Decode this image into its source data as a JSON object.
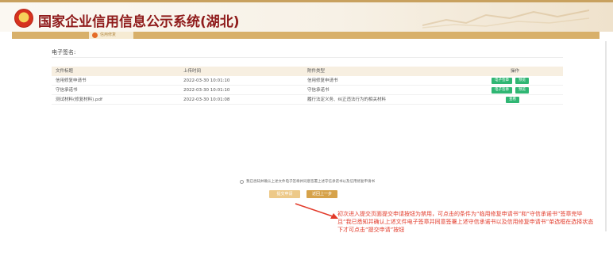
{
  "header": {
    "title": "国家企业信用信息公示系统(湖北)"
  },
  "nav": {
    "tab_label": "信用修复"
  },
  "section": {
    "label": "电子签名:"
  },
  "table": {
    "columns": [
      "文件标题",
      "上传时间",
      "附件类型",
      "操作"
    ],
    "rows": [
      {
        "title": "信用修复申请书",
        "time": "2022-03-30 10:01:10",
        "type": "信用修复申请书",
        "actions": [
          "电子签章",
          "预览"
        ]
      },
      {
        "title": "守信承诺书",
        "time": "2022-03-30 10:01:10",
        "type": "守信承诺书",
        "actions": [
          "电子签章",
          "预览"
        ]
      },
      {
        "title": "测试材料(修复材料).pdf",
        "time": "2022-03-30 10:01:08",
        "type": "履行法定义务、纠正违法行为的相关材料",
        "actions": [
          "查看"
        ]
      }
    ]
  },
  "agreement": {
    "text": "我已悉知并确认上述文件电子签章并同意签署上述守信承诺书以及信用修复申请书"
  },
  "buttons": {
    "submit": "提交申请",
    "back": "返回上一步"
  },
  "annotation": {
    "text": "初次进入提交页面提交申请按钮为禁用，可点击的条件为“临用修复申请书”和“守信承诺书”签章完毕且“我已悉知并确认上述文件电子签章并同意签署上述守信承诺书以及信用修复申请书”单选框在选择状态下才可点击“提交申请”按钮",
    "color": "#e23a2a"
  },
  "colors": {
    "accent": "#d8b06a",
    "action_green": "#2fb673",
    "title_red": "#8f1b1b"
  }
}
